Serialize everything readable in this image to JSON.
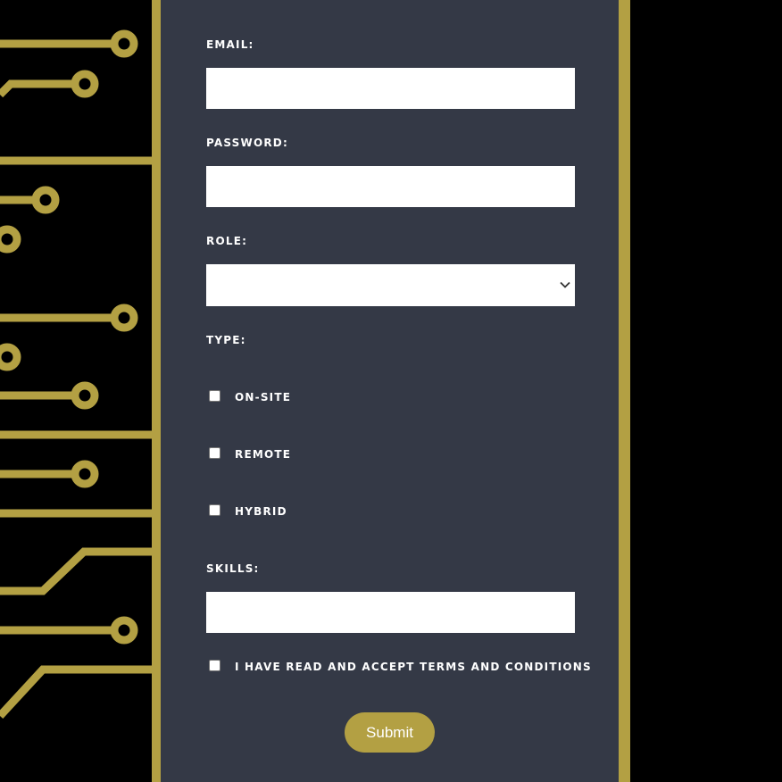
{
  "theme": {
    "background": "#000000",
    "panel": "#343946",
    "circuit_gold": "#b3a043",
    "input_background": "#ffffff",
    "label_color": "#ffffff"
  },
  "form": {
    "email": {
      "label": "EMAIL:",
      "value": ""
    },
    "password": {
      "label": "PASSWORD:",
      "value": ""
    },
    "role": {
      "label": "ROLE:",
      "selected": "",
      "icon": "chevron-down-icon"
    },
    "type": {
      "label": "TYPE:",
      "options": [
        {
          "label": "ON-SITE",
          "checked": false
        },
        {
          "label": "REMOTE",
          "checked": false
        },
        {
          "label": "HYBRID",
          "checked": false
        }
      ]
    },
    "skills": {
      "label": "SKILLS:",
      "value": ""
    },
    "terms": {
      "label": "I HAVE READ AND ACCEPT TERMS AND CONDITIONS",
      "checked": false
    },
    "submit_label": "Submit"
  }
}
